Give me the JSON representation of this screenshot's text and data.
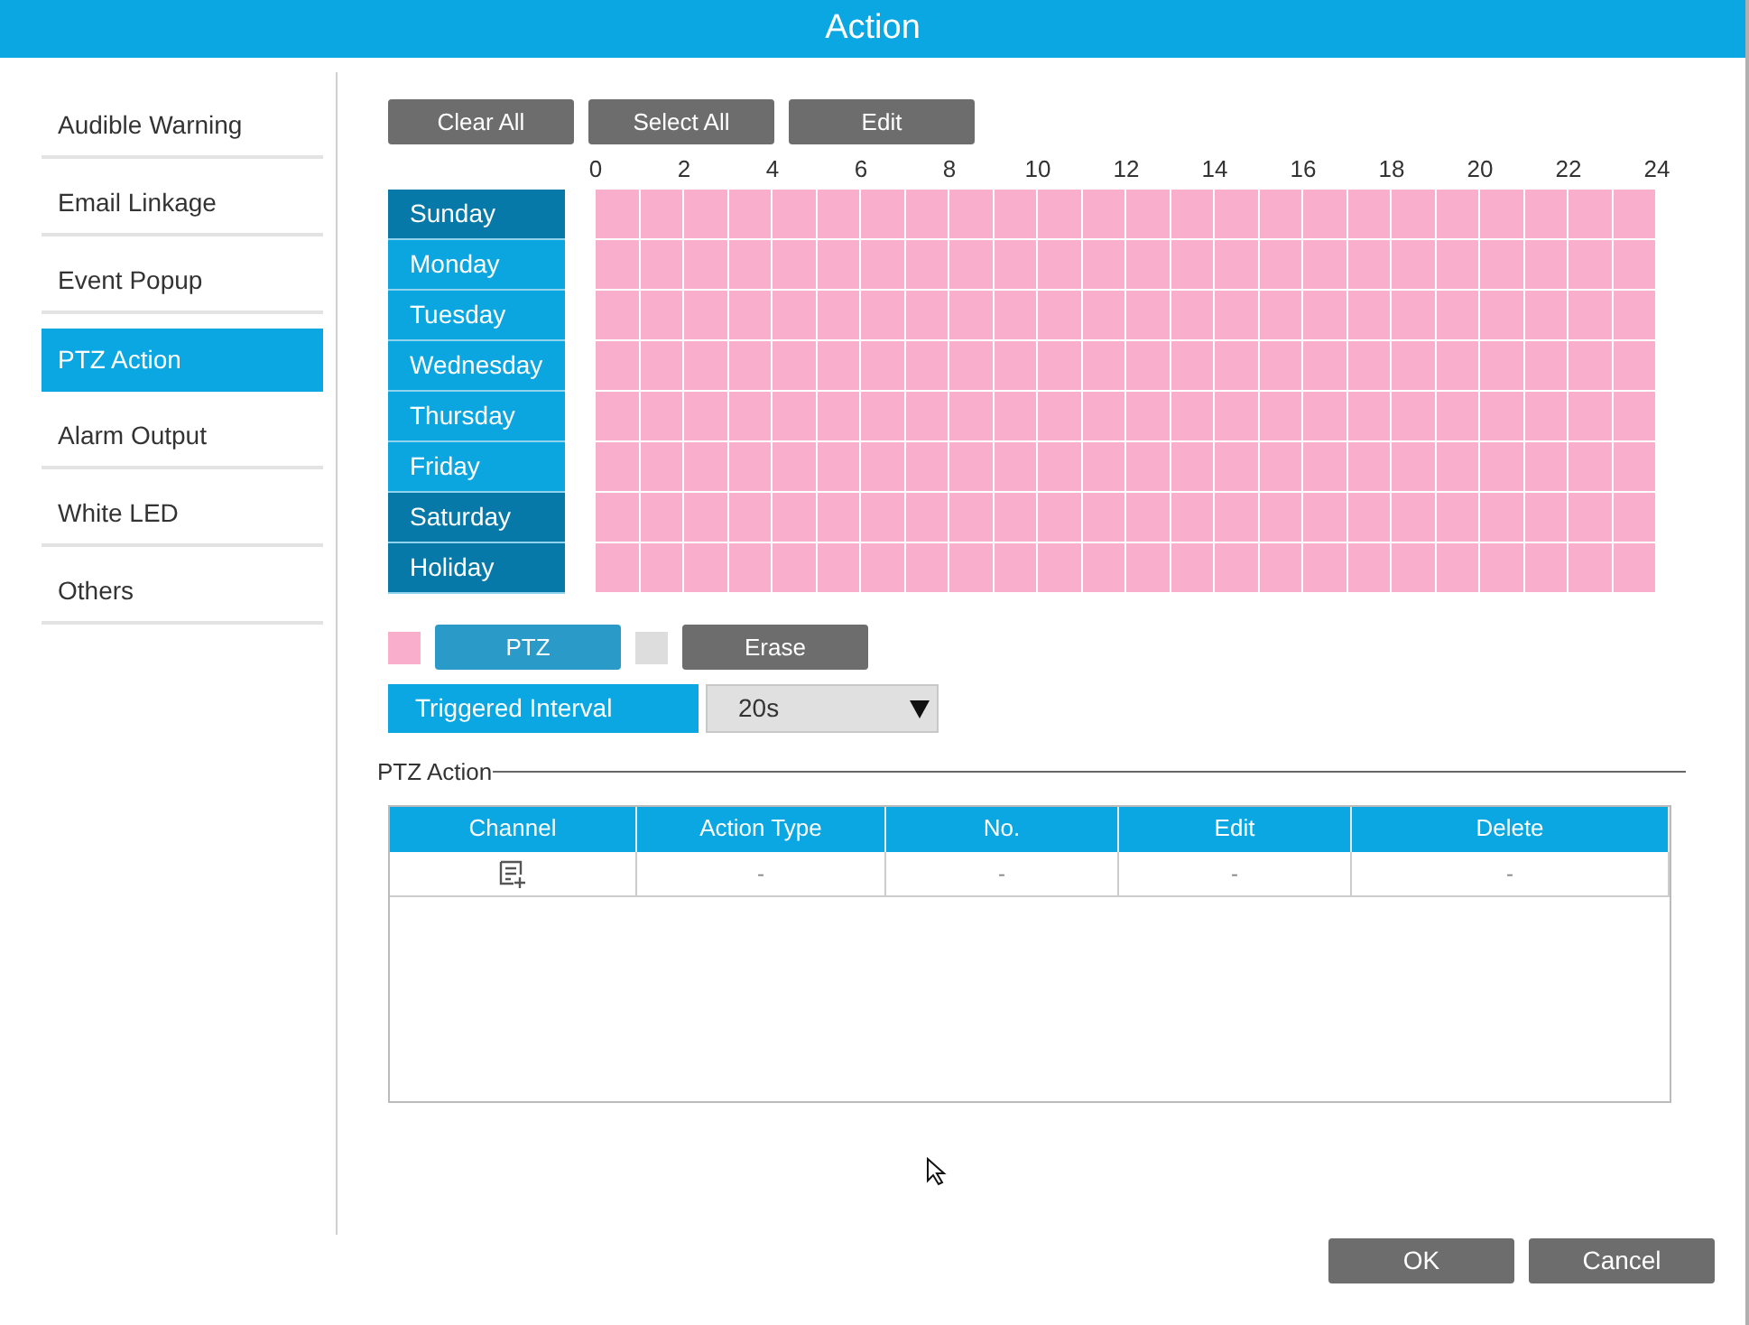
{
  "window": {
    "title": "Action"
  },
  "sidebar": {
    "items": [
      {
        "label": "Audible Warning",
        "selected": false
      },
      {
        "label": "Email Linkage",
        "selected": false
      },
      {
        "label": "Event Popup",
        "selected": false
      },
      {
        "label": "PTZ Action",
        "selected": true
      },
      {
        "label": "Alarm Output",
        "selected": false
      },
      {
        "label": "White LED",
        "selected": false
      },
      {
        "label": "Others",
        "selected": false
      }
    ]
  },
  "toolbar": [
    "Clear All",
    "Select All",
    "Edit"
  ],
  "schedule": {
    "hours": [
      "0",
      "2",
      "4",
      "6",
      "8",
      "10",
      "12",
      "14",
      "16",
      "18",
      "20",
      "22",
      "24"
    ],
    "days": [
      {
        "label": "Sunday",
        "selected": true,
        "scheduled": true
      },
      {
        "label": "Monday",
        "selected": false,
        "scheduled": true
      },
      {
        "label": "Tuesday",
        "selected": false,
        "scheduled": true
      },
      {
        "label": "Wednesday",
        "selected": false,
        "scheduled": true
      },
      {
        "label": "Thursday",
        "selected": false,
        "scheduled": true
      },
      {
        "label": "Friday",
        "selected": false,
        "scheduled": true
      },
      {
        "label": "Saturday",
        "selected": true,
        "scheduled": true
      },
      {
        "label": "Holiday",
        "selected": true,
        "scheduled": true
      }
    ]
  },
  "legend": [
    {
      "label": "PTZ",
      "color": "#f9aecb",
      "selected": true
    },
    {
      "label": "Erase",
      "color": "#dddddd",
      "selected": false
    }
  ],
  "triggered_interval": {
    "label": "Triggered Interval",
    "value": "20s"
  },
  "ptz_action": {
    "title": "PTZ Action",
    "columns": [
      "Channel",
      "Action Type",
      "No.",
      "Edit",
      "Delete"
    ],
    "rows": [
      [
        {
          "kind": "add"
        },
        {
          "kind": "text",
          "text": "-"
        },
        {
          "kind": "text",
          "text": "-"
        },
        {
          "kind": "text",
          "text": "-"
        },
        {
          "kind": "text",
          "text": "-"
        }
      ]
    ]
  },
  "buttons": [
    "OK",
    "Cancel"
  ]
}
